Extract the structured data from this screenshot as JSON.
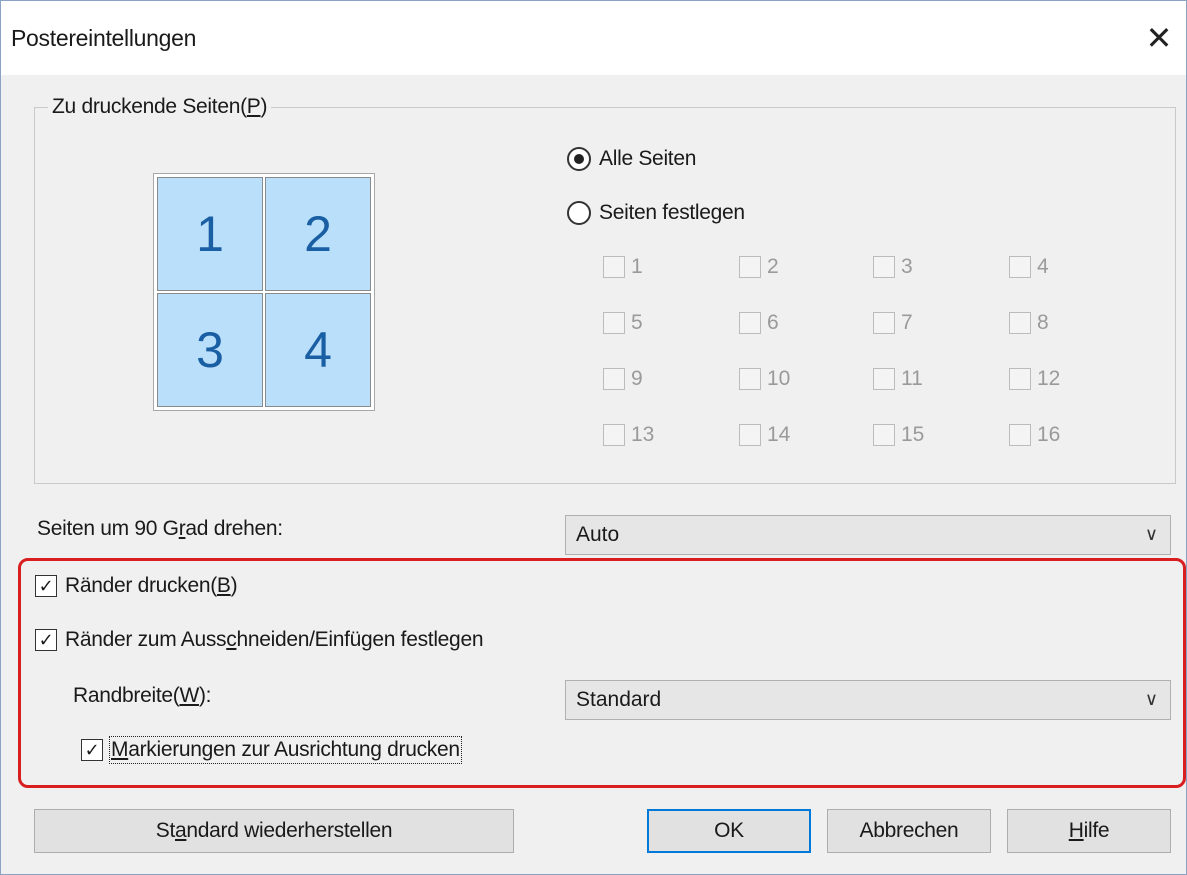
{
  "window": {
    "title": "Postereintellungen",
    "close_glyph": "✕"
  },
  "pages_group": {
    "legend_prefix": "Zu druckende Seiten(",
    "legend_key": "P",
    "legend_suffix": ")",
    "preview_tiles": [
      "1",
      "2",
      "3",
      "4"
    ],
    "radio_all": {
      "label": "Alle Seiten",
      "selected": true
    },
    "radio_specific": {
      "label": "Seiten festlegen",
      "selected": false
    },
    "page_checkboxes": [
      "1",
      "2",
      "3",
      "4",
      "5",
      "6",
      "7",
      "8",
      "9",
      "10",
      "11",
      "12",
      "13",
      "14",
      "15",
      "16"
    ]
  },
  "rotate": {
    "label_prefix": "Seiten um 90 G",
    "label_key": "r",
    "label_suffix": "ad drehen:",
    "value": "Auto"
  },
  "borders": {
    "print_borders": {
      "prefix": "Ränder drucken(",
      "key": "B",
      "suffix": ")",
      "checked": true
    },
    "cut_paste": {
      "prefix": "Ränder zum Auss",
      "key": "c",
      "suffix": "hneiden/Einfügen festlegen",
      "checked": true
    },
    "width_label_prefix": "Randbreite(",
    "width_label_key": "W",
    "width_label_suffix": "):",
    "width_value": "Standard",
    "align_marks": {
      "key": "M",
      "suffix": "arkierungen zur Ausrichtung drucken",
      "checked": true
    }
  },
  "buttons": {
    "restore_prefix": "St",
    "restore_key": "a",
    "restore_suffix": "ndard wiederherstellen",
    "ok": "OK",
    "cancel": "Abbrechen",
    "help_key": "H",
    "help_suffix": "ilfe"
  },
  "colors": {
    "highlight": "#d81e1e",
    "tile_fill": "#b9dffa",
    "default_button_border": "#0078d7"
  }
}
